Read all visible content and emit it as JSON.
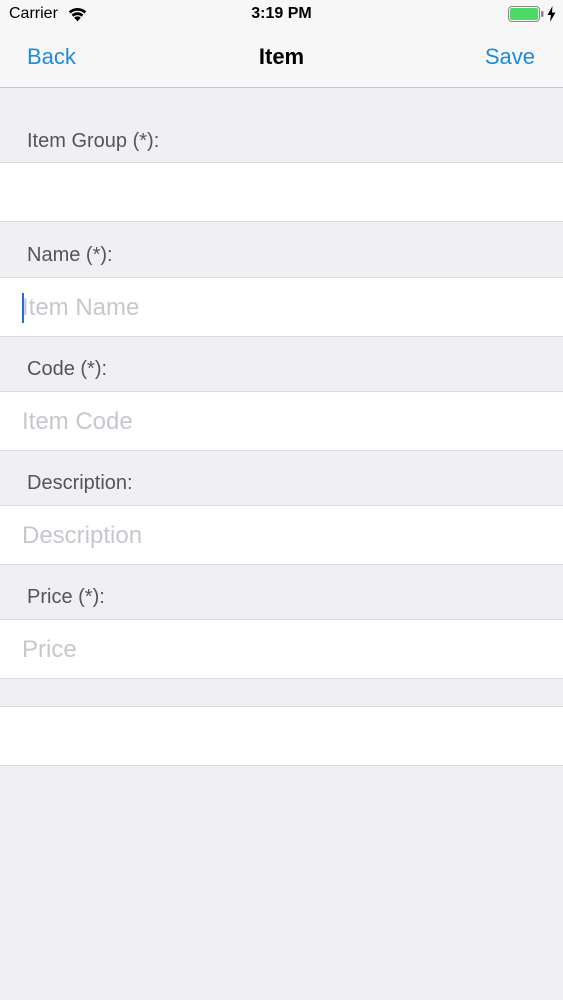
{
  "status_bar": {
    "carrier": "Carrier",
    "time": "3:19 PM",
    "icons": [
      "wifi-icon",
      "battery-icon",
      "charging-icon"
    ],
    "battery_color": "#4cd964"
  },
  "nav": {
    "back_label": "Back",
    "title": "Item",
    "save_label": "Save",
    "accent_color": "#1e8bd8"
  },
  "form": {
    "item_group": {
      "label": "Item Group (*):",
      "value": ""
    },
    "name": {
      "label": "Name (*):",
      "placeholder": "Item Name",
      "value": ""
    },
    "code": {
      "label": "Code (*):",
      "placeholder": "Item Code",
      "value": ""
    },
    "description": {
      "label": "Description:",
      "placeholder": "Description",
      "value": ""
    },
    "price": {
      "label": "Price (*):",
      "placeholder": "Price",
      "value": ""
    }
  }
}
